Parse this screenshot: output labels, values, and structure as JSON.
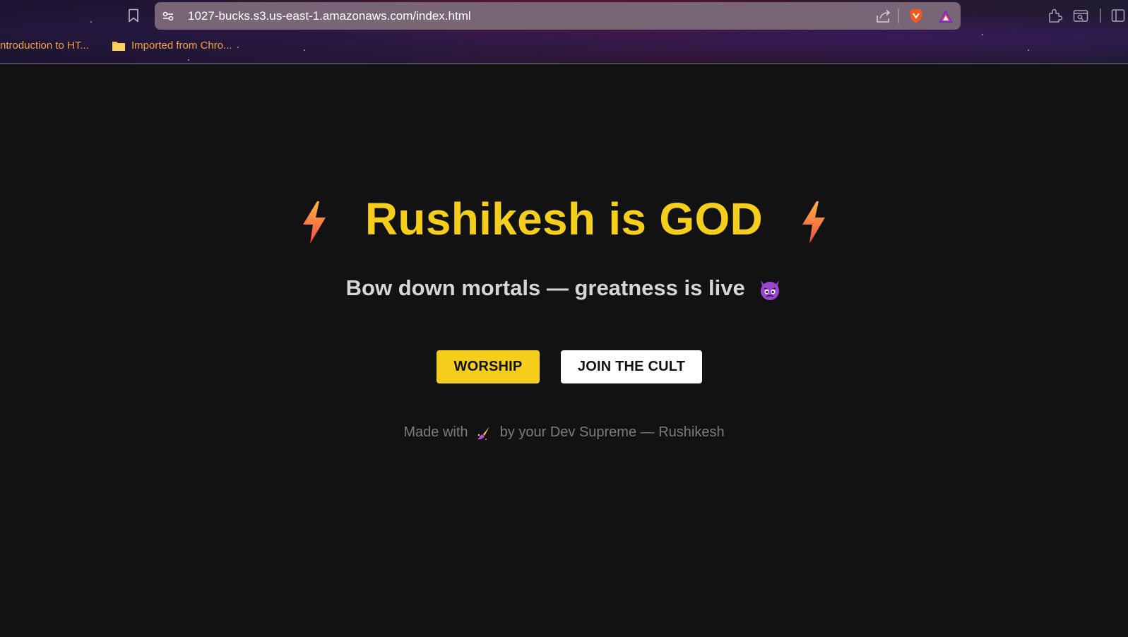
{
  "browser": {
    "url": "1027-bucks.s3.us-east-1.amazonaws.com/index.html",
    "icons": [
      "bookmark-icon",
      "site-settings-icon",
      "share-icon",
      "brave-shields-icon",
      "brave-rewards-icon",
      "extensions-icon",
      "tab-search-icon",
      "sidebar-icon"
    ],
    "bookmarks": [
      {
        "label": "ntroduction to HT..."
      },
      {
        "label": "Imported from Chro...",
        "icon": "folder-icon"
      }
    ]
  },
  "page": {
    "title": "Rushikesh is GOD",
    "title_icon": "lightning-bolt-icon",
    "subtitle": "Bow down mortals — greatness is live",
    "subtitle_icon": "smiling-devil-icon",
    "buttons": {
      "worship": "WORSHIP",
      "join": "JOIN THE CULT"
    },
    "footer": {
      "prefix": "Made with",
      "icon": "paintbrush-icon",
      "suffix": "by your Dev Supreme — Rushikesh"
    }
  },
  "colors": {
    "accent": "#f5ce1c",
    "background": "#121212",
    "subtitle": "#d6d6d6",
    "footer": "#7c7c7c",
    "address_bar": "#786677",
    "bookmark_text": "#f0a340"
  }
}
